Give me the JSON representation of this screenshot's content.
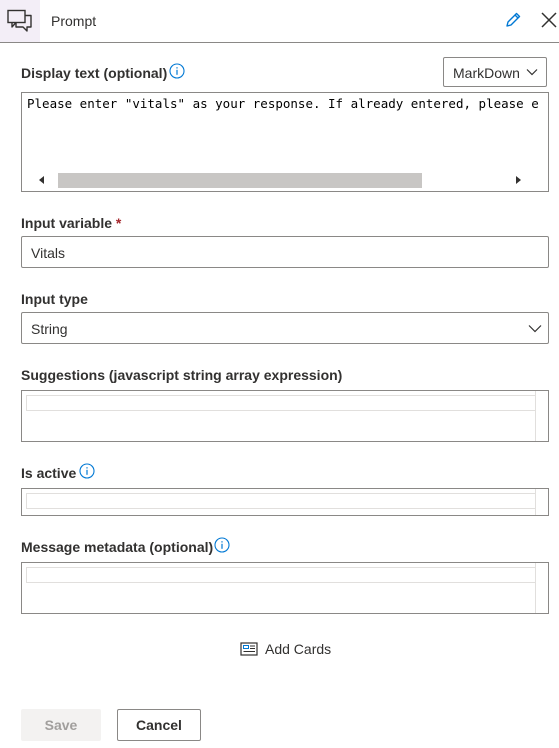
{
  "header": {
    "title": "Prompt",
    "icon": "prompt-chat-icon",
    "edit_icon": "pencil-icon",
    "close_icon": "close-icon"
  },
  "display_text": {
    "label": "Display text (optional)",
    "format_select": "MarkDown",
    "value": "Please enter \"vitals\" as your response. If already entered, please e"
  },
  "input_variable": {
    "label": "Input variable",
    "required_marker": "*",
    "value": "Vitals"
  },
  "input_type": {
    "label": "Input type",
    "value": "String"
  },
  "suggestions": {
    "label": "Suggestions (javascript string array expression)",
    "value": ""
  },
  "is_active": {
    "label": "Is active",
    "value": ""
  },
  "message_metadata": {
    "label": "Message metadata (optional)",
    "value": ""
  },
  "add_cards": {
    "label": "Add Cards",
    "icon": "card-icon"
  },
  "footer": {
    "save_label": "Save",
    "cancel_label": "Cancel"
  },
  "colors": {
    "accent": "#0078d4",
    "header_icon_bg": "#f3eef7",
    "required": "#a4262c",
    "border": "#8a8886"
  }
}
